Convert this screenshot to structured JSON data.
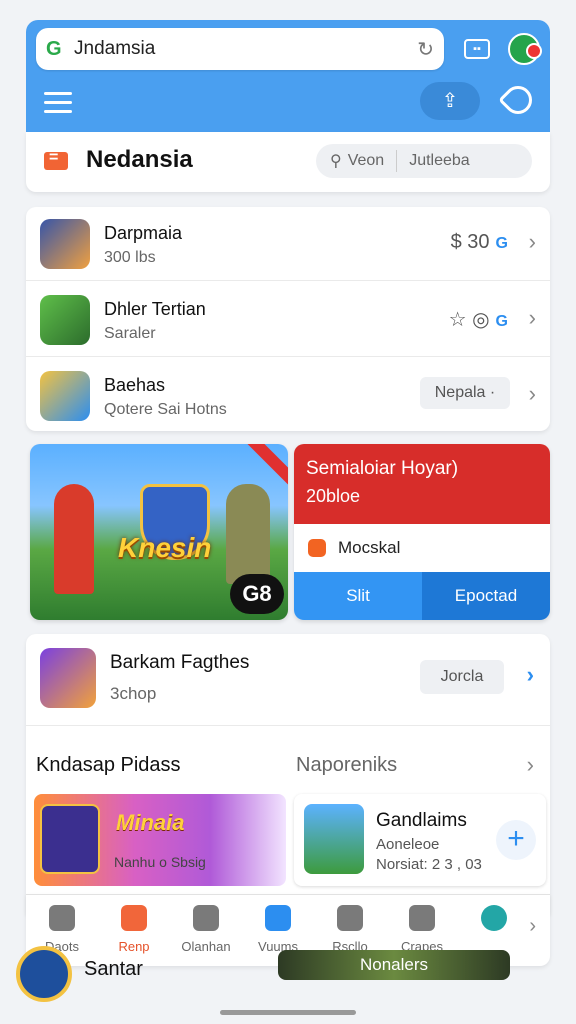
{
  "browser": {
    "url_text": "Jndamsia"
  },
  "header": {
    "title": "Nedansia",
    "search_pill": {
      "left": "Veon",
      "right": "Jutleeba"
    }
  },
  "list_items": [
    {
      "title": "Darpmaia",
      "subtitle": "300 lbs",
      "meta": "$ 30",
      "meta_accent": "G"
    },
    {
      "title": "Dhler Tertian",
      "subtitle": "Saraler",
      "meta": "☆ ◎",
      "meta_accent": "G"
    },
    {
      "title": "Baehas",
      "subtitle": "Qotere Sai Hotns",
      "chip": "Nepala ·"
    }
  ],
  "banner": {
    "title": "Knesin",
    "badge": "G8"
  },
  "promo": {
    "title": "Semialoiar Hoyar)",
    "subtitle": "20bloe",
    "mid_text": "Mocskal",
    "button_left": "Slit",
    "button_right": "Epoctad"
  },
  "feature": {
    "title": "Barkam Fagthes",
    "subtitle": "3chop",
    "chip": "Jorcla"
  },
  "section": {
    "left": "Kndasap Pidass",
    "right": "Naporeniks"
  },
  "mini_cards": [
    {
      "title": "Minaia",
      "subtitle": "Nanhu o Sbsig"
    },
    {
      "title": "Gandlaims",
      "sub1": "Aoneleoe",
      "sub2": "Norsiat: 2 3 , 03"
    }
  ],
  "bottom_nav": [
    {
      "label": "Daots"
    },
    {
      "label": "Renp"
    },
    {
      "label": "Olanhan"
    },
    {
      "label": "Vuums"
    },
    {
      "label": "Rscllo"
    },
    {
      "label": "Crapes"
    },
    {
      "label": ""
    }
  ],
  "peek": {
    "left_title": "Santar",
    "banner": "Nonalers"
  },
  "colors": {
    "accent": "#4a9ff0",
    "promo_red": "#d72d2a",
    "nav_active": "#e5522a"
  }
}
